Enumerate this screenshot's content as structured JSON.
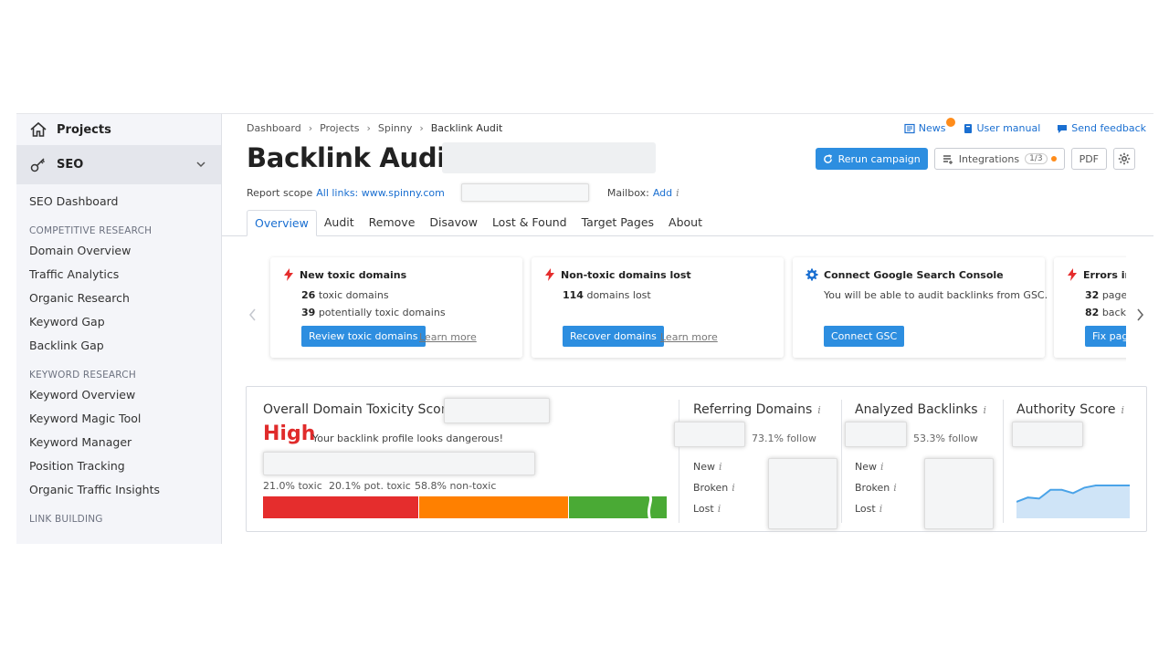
{
  "sidebar": {
    "projects_label": "Projects",
    "seo_label": "SEO",
    "dashboard": "SEO Dashboard",
    "sections": [
      {
        "title": "COMPETITIVE RESEARCH",
        "items": [
          "Domain Overview",
          "Traffic Analytics",
          "Organic Research",
          "Keyword Gap",
          "Backlink Gap"
        ]
      },
      {
        "title": "KEYWORD RESEARCH",
        "items": [
          "Keyword Overview",
          "Keyword Magic Tool",
          "Keyword Manager",
          "Position Tracking",
          "Organic Traffic Insights"
        ]
      },
      {
        "title": "LINK BUILDING",
        "items": []
      }
    ]
  },
  "breadcrumb": [
    "Dashboard",
    "Projects",
    "Spinny",
    "Backlink Audit"
  ],
  "toplinks": {
    "news": "News",
    "manual": "User manual",
    "feedback": "Send feedback"
  },
  "title": "Backlink Audit:",
  "actions": {
    "rerun": "Rerun campaign",
    "integrations": "Integrations",
    "integrations_count": "1/3",
    "pdf": "PDF"
  },
  "scope": {
    "label": "Report scope",
    "link": "All links: www.spinny.com",
    "mailbox_label": "Mailbox:",
    "mailbox_link": "Add",
    "info": "i"
  },
  "tabs": [
    "Overview",
    "Audit",
    "Remove",
    "Disavow",
    "Lost & Found",
    "Target Pages",
    "About"
  ],
  "cards": [
    {
      "title": "New toxic domains",
      "line1_num": "26",
      "line1_text": "toxic domains",
      "line2_num": "39",
      "line2_text": "potentially toxic domains",
      "button": "Review toxic domains",
      "learn": "Learn more"
    },
    {
      "title": "Non-toxic domains lost",
      "line1_num": "114",
      "line1_text": "domains lost",
      "button": "Recover domains",
      "learn": "Learn more"
    },
    {
      "title": "Connect Google Search Console",
      "line1_text": "You will be able to audit backlinks from GSC.",
      "button": "Connect GSC"
    },
    {
      "title": "Errors in",
      "line1_num": "32",
      "line1_text": "pages",
      "line2_num": "82",
      "line2_text": "backli",
      "button": "Fix pag"
    }
  ],
  "toxicity": {
    "title": "Overall Domain Toxicity Score",
    "level": "High",
    "message": "Your backlink profile looks dangerous!",
    "toxic_label": "21.0% toxic",
    "pot_label": "20.1% pot. toxic",
    "non_label": "58.8% non-toxic",
    "toxic": 21.0,
    "pot": 20.1,
    "non": 58.8,
    "colors": {
      "toxic": "#e52d2d",
      "pot": "#ff8000",
      "non": "#4aaa35"
    }
  },
  "referring": {
    "title": "Referring Domains",
    "follow": "73.1% follow",
    "new": "New",
    "broken": "Broken",
    "lost": "Lost"
  },
  "analyzed": {
    "title": "Analyzed Backlinks",
    "follow": "53.3% follow",
    "new": "New",
    "broken": "Broken",
    "lost": "Lost"
  },
  "authority": {
    "title": "Authority Score",
    "trend": [
      0.3,
      0.38,
      0.36,
      0.52,
      0.52,
      0.46,
      0.56,
      0.6,
      0.6,
      0.6,
      0.6
    ]
  },
  "info_glyph": "i"
}
